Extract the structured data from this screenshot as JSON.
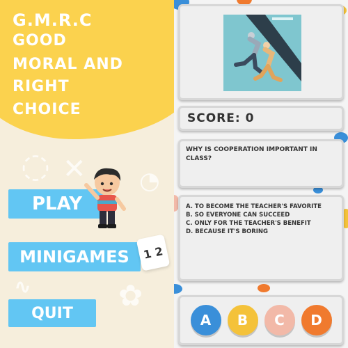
{
  "menu": {
    "title_lines": [
      "G.M.R.C",
      "GOOD",
      "MORAL AND",
      "RIGHT",
      "CHOICE"
    ],
    "play_label": "PLAY",
    "minigames_label": "MINIGAMES",
    "minigames_badge": "1 2",
    "quit_label": "QUIT",
    "colors": {
      "yellow": "#fbd24e",
      "button_blue": "#62c6f3"
    }
  },
  "quiz": {
    "score_text": "SCORE: 0",
    "question": "WHY IS COOPERATION IMPORTANT IN CLASS?",
    "choices": [
      "A. TO BECOME THE TEACHER'S FAVORITE",
      "B. SO EVERYONE CAN SUCCEED",
      "C. ONLY FOR THE TEACHER'S BENEFIT",
      "D. BECAUSE IT'S BORING"
    ],
    "answer_buttons": [
      {
        "label": "A",
        "color": "#3a8fd9"
      },
      {
        "label": "B",
        "color": "#f4c23a"
      },
      {
        "label": "C",
        "color": "#f2b9a8"
      },
      {
        "label": "D",
        "color": "#f07a2e"
      }
    ]
  }
}
